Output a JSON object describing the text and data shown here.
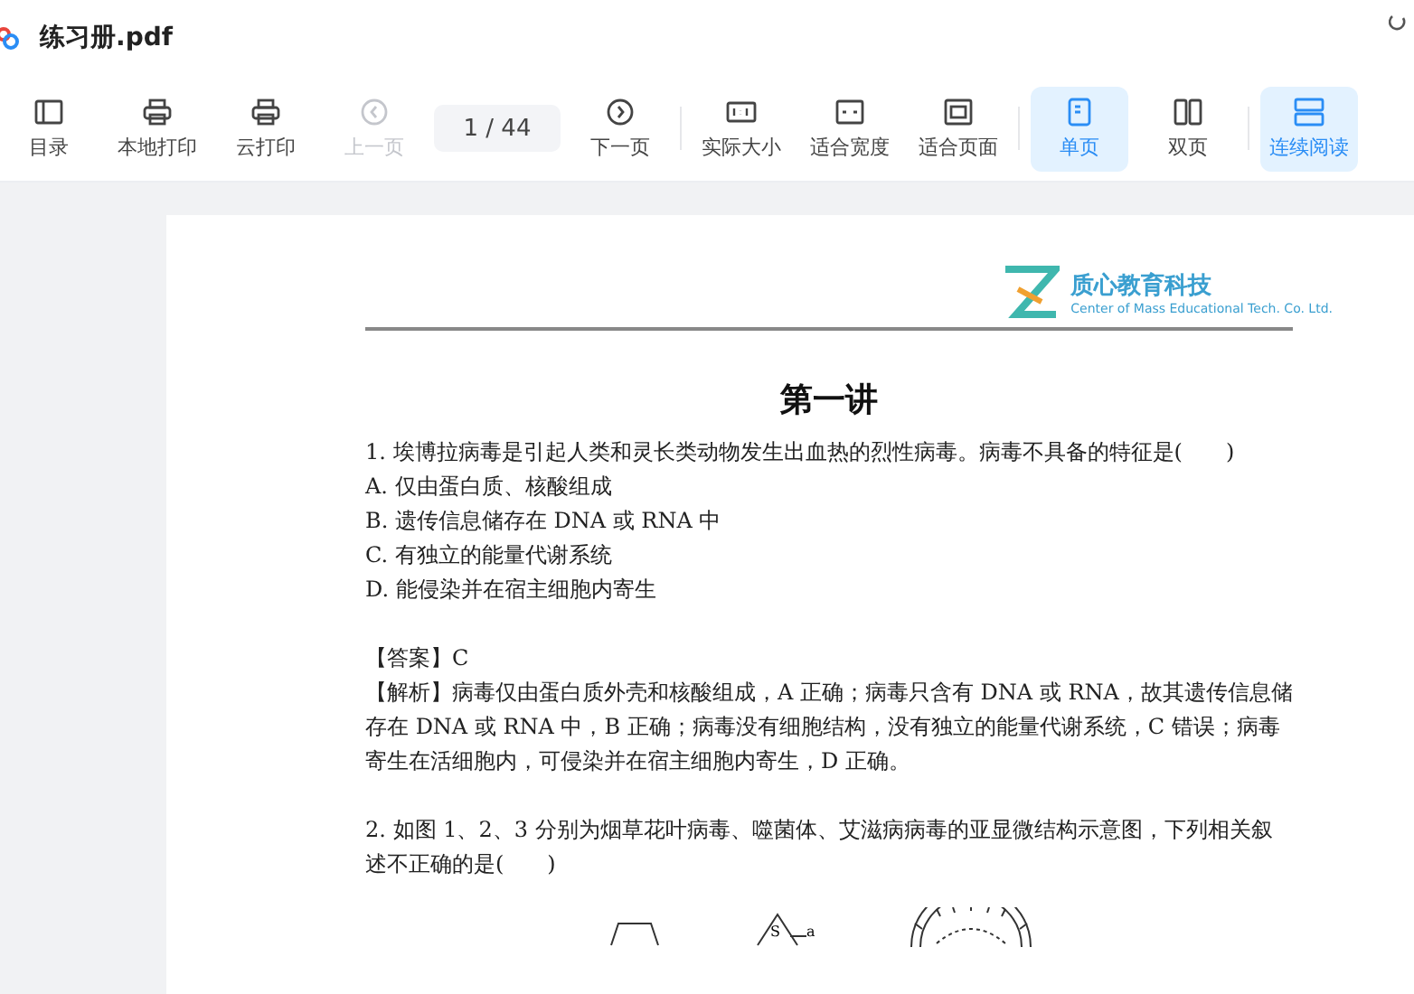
{
  "window": {
    "title": "练习册.pdf"
  },
  "toolbar": [
    {
      "kind": "button",
      "label": "目录",
      "disabled": false,
      "selected": false
    },
    {
      "kind": "button",
      "label": "本地打印",
      "disabled": false,
      "selected": false
    },
    {
      "kind": "button",
      "label": "云打印",
      "disabled": false,
      "selected": false
    },
    {
      "kind": "button",
      "label": "上一页",
      "disabled": true,
      "selected": false
    },
    {
      "kind": "page",
      "value": "1 / 44"
    },
    {
      "kind": "button",
      "label": "下一页",
      "disabled": false,
      "selected": false
    },
    {
      "kind": "separator"
    },
    {
      "kind": "button",
      "label": "实际大小",
      "disabled": false,
      "selected": false
    },
    {
      "kind": "button",
      "label": "适合宽度",
      "disabled": false,
      "selected": false
    },
    {
      "kind": "button",
      "label": "适合页面",
      "disabled": false,
      "selected": false
    },
    {
      "kind": "separator"
    },
    {
      "kind": "button",
      "label": "单页",
      "disabled": false,
      "selected": true
    },
    {
      "kind": "button",
      "label": "双页",
      "disabled": false,
      "selected": false
    },
    {
      "kind": "separator"
    },
    {
      "kind": "button",
      "label": "连续阅读",
      "disabled": false,
      "selected": true
    }
  ],
  "document": {
    "header": {
      "company": "质心教育科技",
      "company_en": "Center of Mass Educational Tech. Co. Ltd."
    },
    "title": "第一讲",
    "paragraphs": [
      {
        "kind": "question",
        "text": "1.  埃博拉病毒是引起人类和灵长类动物发生出血热的烈性病毒。病毒不具备的特征是(　　)"
      },
      {
        "kind": "option",
        "text": "A.  仅由蛋白质、核酸组成"
      },
      {
        "kind": "option",
        "text": "B.  遗传信息储存在 DNA 或 RNA 中"
      },
      {
        "kind": "option",
        "text": "C.  有独立的能量代谢系统"
      },
      {
        "kind": "option",
        "text": "D.  能侵染并在宿主细胞内寄生"
      },
      {
        "kind": "answer",
        "text": "【答案】C"
      },
      {
        "kind": "explanation",
        "text": "【解析】病毒仅由蛋白质外壳和核酸组成，A 正确；病毒只含有 DNA 或 RNA，故其遗传信息储存在 DNA 或 RNA 中，B 正确；病毒没有细胞结构，没有独立的能量代谢系统，C 错误；病毒寄生在活细胞内，可侵染并在宿主细胞内寄生，D 正确。"
      },
      {
        "kind": "question",
        "text": "2. 如图 1、2、3 分别为烟草花叶病毒、噬菌体、艾滋病病毒的亚显微结构示意图，下列相关叙述不正确的是(　　)"
      }
    ],
    "figure_labels": [
      "S",
      "a"
    ]
  }
}
